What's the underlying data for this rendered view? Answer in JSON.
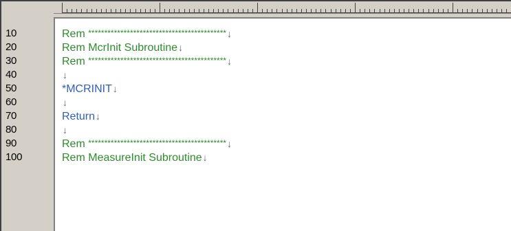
{
  "ruler": {
    "label": ""
  },
  "line_numbers": [
    "10",
    "20",
    "30",
    "40",
    "50",
    "60",
    "70",
    "80",
    "90",
    "100"
  ],
  "code_lines": [
    {
      "keyword": "Rem",
      "text": "*******************************************",
      "eol": "↓",
      "color": "green"
    },
    {
      "keyword": "Rem",
      "text": "McrInit Subroutine",
      "eol": "↓",
      "color": "green"
    },
    {
      "keyword": "Rem",
      "text": "*******************************************",
      "eol": "↓",
      "color": "green"
    },
    {
      "keyword": "",
      "text": "",
      "eol": "↓",
      "color": "green"
    },
    {
      "keyword": "",
      "text": "*MCRINIT",
      "eol": "↓",
      "color": "blue"
    },
    {
      "keyword": "",
      "text": "",
      "eol": "↓",
      "color": "green"
    },
    {
      "keyword": "",
      "text": "Return",
      "eol": "↓",
      "color": "blue"
    },
    {
      "keyword": "",
      "text": "",
      "eol": "↓",
      "color": "green"
    },
    {
      "keyword": "Rem",
      "text": "*******************************************",
      "eol": "↓",
      "color": "green"
    },
    {
      "keyword": "Rem",
      "text": "MeasureInit Subroutine",
      "eol": "↓",
      "color": "green"
    }
  ],
  "colors": {
    "comment": "#2e8b2e",
    "command": "#2f5fb7",
    "eol_marker": "#6a6a6a"
  }
}
